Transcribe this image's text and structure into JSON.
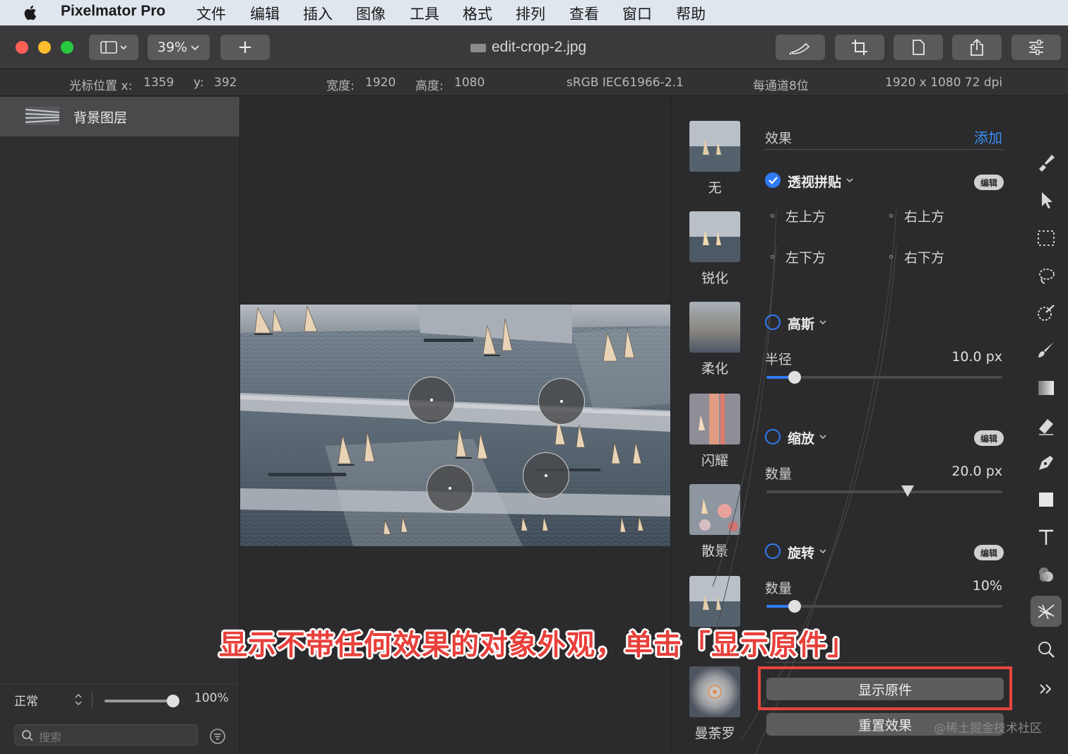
{
  "menubar": {
    "app_name": "Pixelmator Pro",
    "items": [
      "文件",
      "编辑",
      "插入",
      "图像",
      "工具",
      "格式",
      "排列",
      "查看",
      "窗口",
      "帮助"
    ]
  },
  "toolbar": {
    "zoom": "39%",
    "add_label": "+",
    "document_title": "edit-crop-2.jpg"
  },
  "infobar": {
    "cursor_x_label": "光标位置 x:",
    "cursor_x": "1359",
    "cursor_y_label": "y:",
    "cursor_y": "392",
    "width_label": "宽度:",
    "width": "1920",
    "height_label": "高度:",
    "height": "1080",
    "color_profile": "sRGB IEC61966-2.1",
    "bit_depth": "每通道8位",
    "dimensions": "1920 x 1080 72 dpi"
  },
  "layers": {
    "items": [
      {
        "name": "背景图层"
      }
    ],
    "blend_mode": "正常",
    "opacity": "100%",
    "opacity_fraction": 1.0,
    "search_placeholder": "搜索"
  },
  "effect_presets": [
    {
      "label": "无",
      "icon": "sailboats-thumb"
    },
    {
      "label": "锐化",
      "icon": "sailboats-thumb"
    },
    {
      "label": "柔化",
      "icon": "blur-thumb"
    },
    {
      "label": "闪耀",
      "icon": "glow-thumb"
    },
    {
      "label": "散景",
      "icon": "bokeh-thumb"
    },
    {
      "label": "",
      "icon": "sailboats-thumb"
    },
    {
      "label": "曼荼罗",
      "icon": "mandala-thumb"
    }
  ],
  "effects_panel": {
    "heading": "效果",
    "add_label": "添加",
    "edit_badge": "编辑",
    "perspective": {
      "name": "透视拼贴",
      "enabled": true,
      "corners": [
        "左上方",
        "右上方",
        "左下方",
        "右下方"
      ]
    },
    "gaussian": {
      "name": "高斯",
      "enabled": false,
      "param_label": "半径",
      "param_value": "10.0 px",
      "fraction": 0.12
    },
    "zoom": {
      "name": "缩放",
      "enabled": false,
      "param_label": "数量",
      "param_value": "20.0 px",
      "fraction": 0.6
    },
    "rotate": {
      "name": "旋转",
      "enabled": false,
      "param_label": "数量",
      "param_value": "10%",
      "fraction": 0.12
    },
    "show_original_label": "显示原件",
    "reset_label": "重置效果"
  },
  "tools": [
    "brush-style-icon",
    "arrow-select-icon",
    "rect-select-icon",
    "lasso-icon",
    "magic-select-icon",
    "paint-brush-icon",
    "gradient-icon",
    "eraser-icon",
    "pen-icon",
    "shape-icon",
    "text-icon",
    "color-adjust-icon",
    "effects-icon",
    "zoom-icon",
    "more-icon"
  ],
  "caption": "显示不带任何效果的对象外观，单击「显示原件」",
  "watermark": "@稀土掘金技术社区",
  "colors": {
    "accent": "#2f7bf5",
    "highlight": "#e8453c",
    "caption": "#e8403a"
  }
}
